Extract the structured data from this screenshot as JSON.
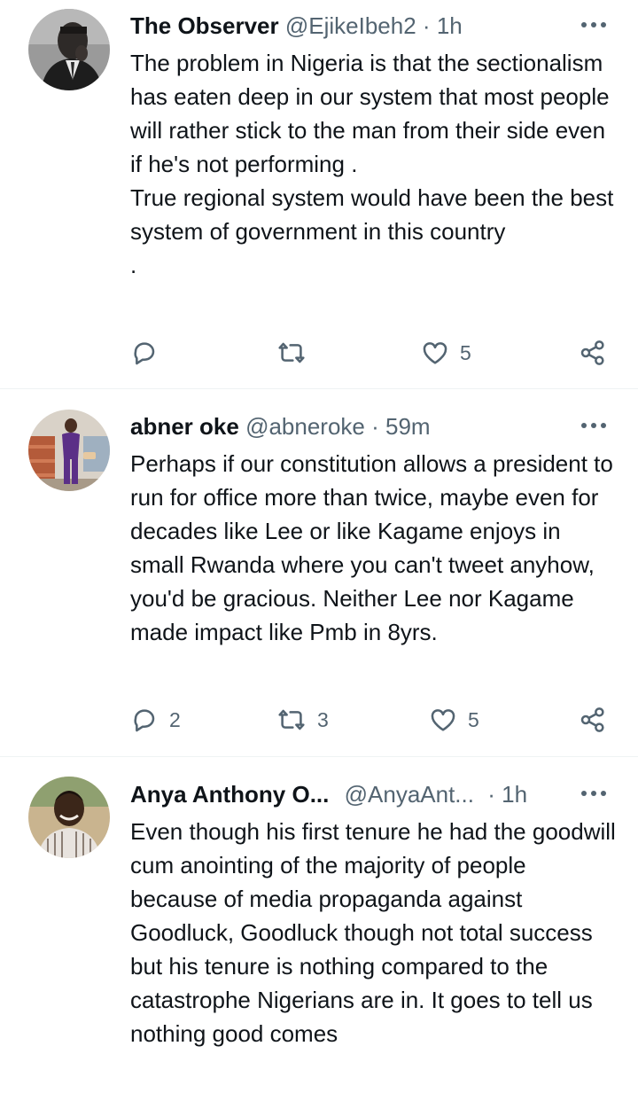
{
  "tweets": [
    {
      "name": "The Observer",
      "handle": "@EjikeIbeh2",
      "separator": "·",
      "time": "1h",
      "text": "The problem in Nigeria is that the sectionalism has eaten deep in our system that most people will rather stick to the man from their side even if he's not performing .\nTrue regional system would have been the best system of government in this country\n.",
      "replies": "",
      "retweets": "",
      "likes": "5"
    },
    {
      "name": "abner oke",
      "handle": "@abneroke",
      "separator": "·",
      "time": "59m",
      "text": "Perhaps if our constitution allows a president to run for office more than twice, maybe even for decades like Lee or like Kagame enjoys in small Rwanda where you can't tweet anyhow, you'd be gracious. Neither Lee nor Kagame made impact like Pmb in 8yrs.",
      "replies": "2",
      "retweets": "3",
      "likes": "5"
    },
    {
      "name": "Anya Anthony O...",
      "handle": "@AnyaAnt...",
      "separator": "·",
      "time": "1h",
      "text": "Even though his first tenure he had the goodwill cum anointing of the majority of people because of media propaganda against Goodluck, Goodluck though not total success but his tenure is nothing compared to the catastrophe Nigerians are in. It goes to tell us nothing good comes"
    }
  ],
  "icons": {
    "reply": "reply-icon",
    "retweet": "retweet-icon",
    "like": "heart-icon",
    "share": "share-icon",
    "more": "more-icon"
  },
  "colors": {
    "text": "#0f1419",
    "secondary": "#536471",
    "divider": "#eff3f4"
  }
}
